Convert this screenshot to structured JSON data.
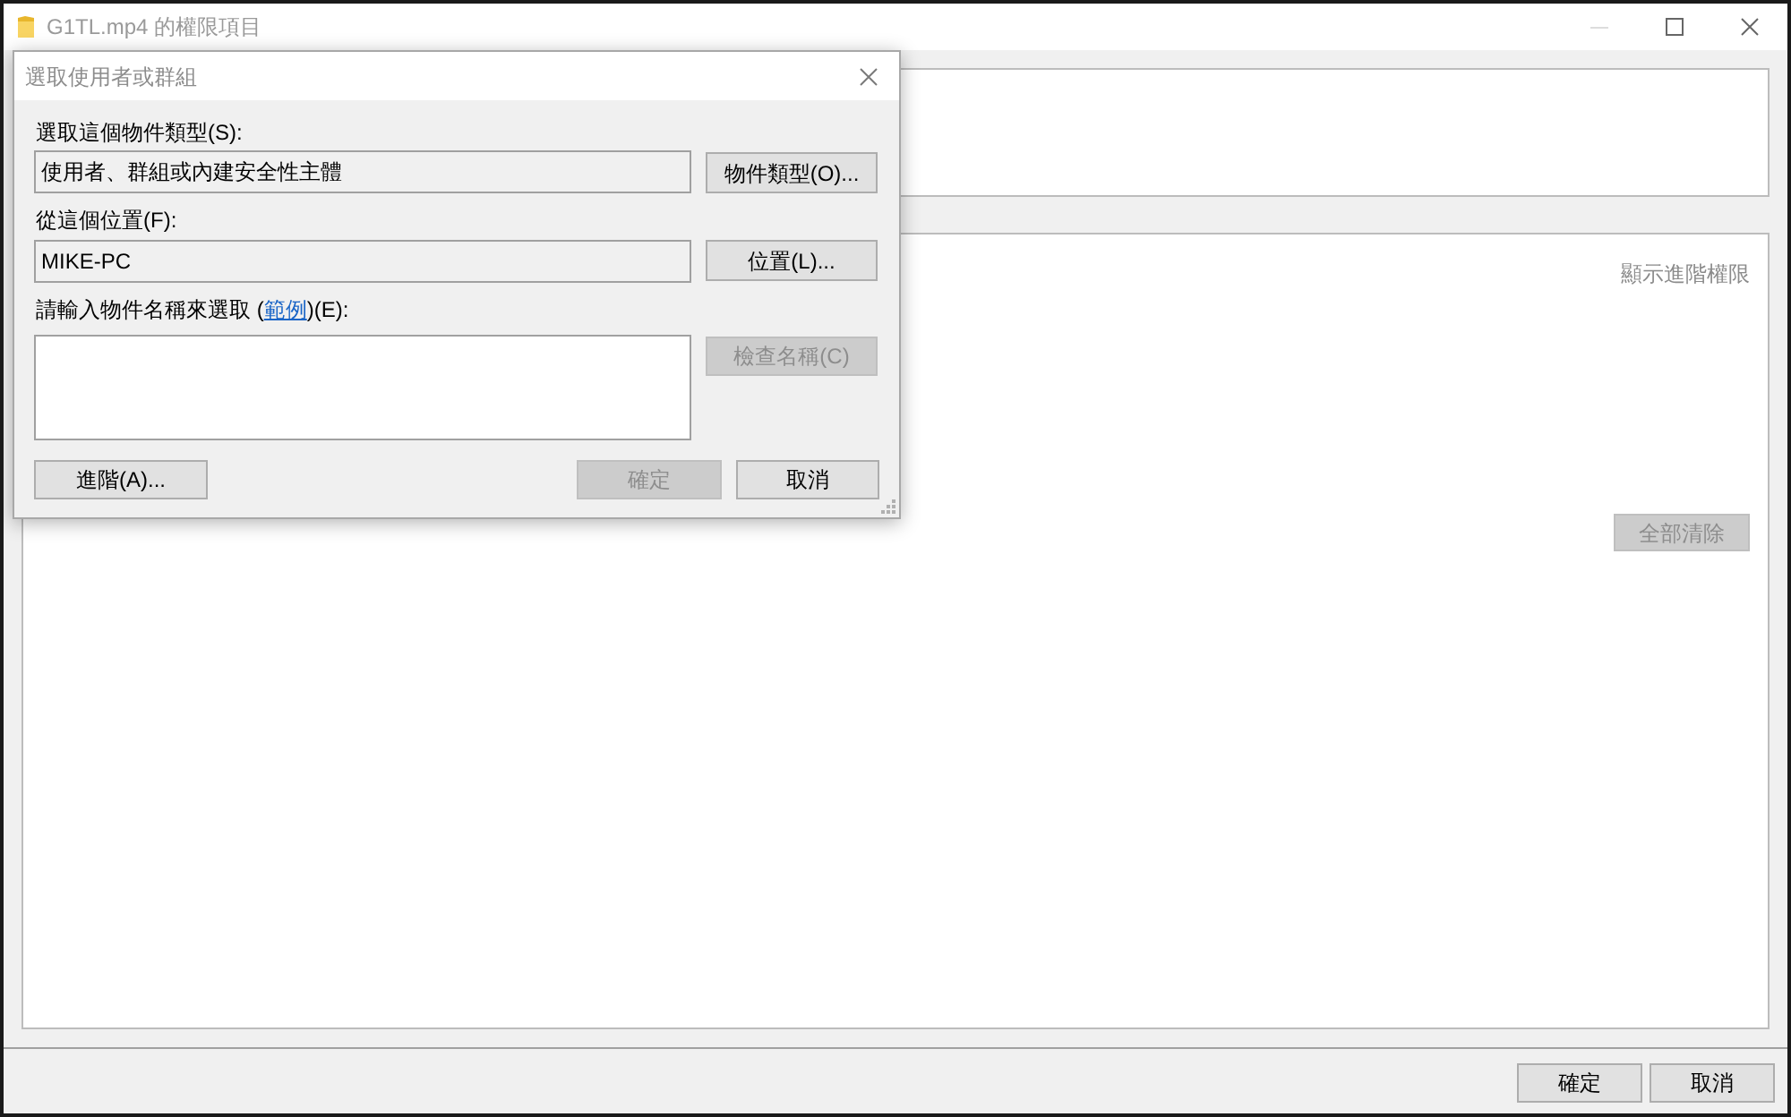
{
  "window": {
    "title": "G1TL.mp4 的權限項目"
  },
  "main": {
    "advanced_link": "顯示進階權限",
    "clear_all_button": {
      "label": "全部清除",
      "disabled": true
    },
    "buttons": [
      {
        "label": "確定"
      },
      {
        "label": "取消"
      }
    ]
  },
  "dialog": {
    "title": "選取使用者或群組",
    "object_type": {
      "label": "選取這個物件類型(S):",
      "value": "使用者、群組或內建安全性主體",
      "button": {
        "label": "物件類型(O)...",
        "disabled": false
      }
    },
    "location": {
      "label": "從這個位置(F):",
      "value": "MIKE-PC",
      "button": {
        "label": "位置(L)...",
        "disabled": false
      }
    },
    "names": {
      "label_before": "請輸入物件名稱來選取 (",
      "link": "範例",
      "label_after": ")(E):",
      "check_button": {
        "label": "檢查名稱(C)",
        "disabled": true
      }
    },
    "buttons": [
      {
        "label": "進階(A)...",
        "disabled": false
      },
      {
        "label": "確定",
        "disabled": true
      },
      {
        "label": "取消",
        "disabled": false
      }
    ]
  }
}
